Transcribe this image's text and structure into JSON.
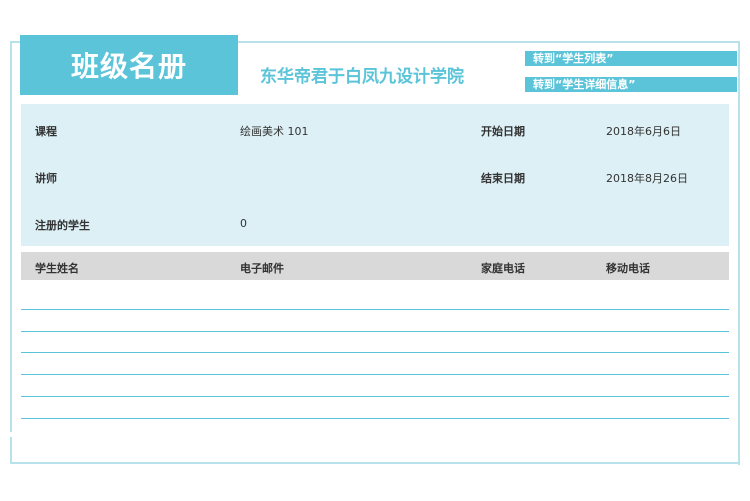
{
  "header": {
    "title": "班级名册",
    "school_name": "东华帝君于白凤九设计学院",
    "links": [
      {
        "label": "转到“学生列表”"
      },
      {
        "label": "转到“学生详细信息”"
      }
    ]
  },
  "course_info": {
    "course_label": "课程",
    "course_value": "绘画美术 101",
    "instructor_label": "讲师",
    "instructor_value": "",
    "enrolled_label": "注册的学生",
    "enrolled_value": "0",
    "start_label": "开始日期",
    "start_value": "2018年6月6日",
    "end_label": "结束日期",
    "end_value": "2018年8月26日"
  },
  "table": {
    "columns": [
      "学生姓名",
      "电子邮件",
      "家庭电话",
      "移动电话"
    ],
    "rows": []
  },
  "colors": {
    "accent": "#5bc4d9",
    "info_bg": "#dcf0f6",
    "header_bg": "#d9d9d9"
  }
}
